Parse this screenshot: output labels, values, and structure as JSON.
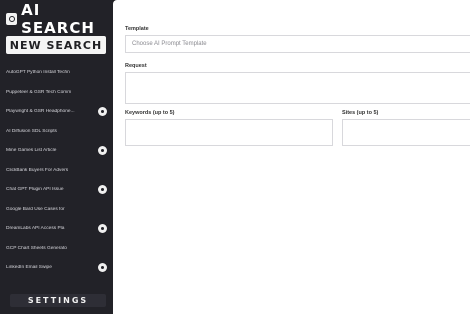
{
  "sidebar": {
    "logo_text": "AI SEARCH",
    "new_search_label": "NEW SEARCH",
    "items": [
      {
        "label": "AutoGPT Python Install Techn",
        "badge": false
      },
      {
        "label": "Puppeteer & GSR Tech Comm",
        "badge": false
      },
      {
        "label": "Playwright & GSR Headphone...",
        "badge": true
      },
      {
        "label": "AI Diffusion SDL Scripts",
        "badge": false
      },
      {
        "label": "Mine Games List Article",
        "badge": true
      },
      {
        "label": "ClickBank Buyers For Advers",
        "badge": false
      },
      {
        "label": "Chat GPT Plugin API Issue",
        "badge": true
      },
      {
        "label": "Google Bard Use Cases for",
        "badge": false
      },
      {
        "label": "DreamLabs API Access Pla",
        "badge": true
      },
      {
        "label": "GCP Chart Sheets Generato",
        "badge": false
      },
      {
        "label": "LinkedIn Email Swipe",
        "badge": true
      }
    ],
    "settings_label": "SETTINGS"
  },
  "main": {
    "template_label": "Template",
    "template_placeholder": "Choose AI Prompt Template",
    "request_label": "Request",
    "keywords_label": "Keywords (up to 5)",
    "sites_label": "Sites (up to 5)"
  },
  "colors": {
    "sidebar_bg": "#222228",
    "main_bg": "#ffffff",
    "button_bg": "#f4f4f4"
  }
}
